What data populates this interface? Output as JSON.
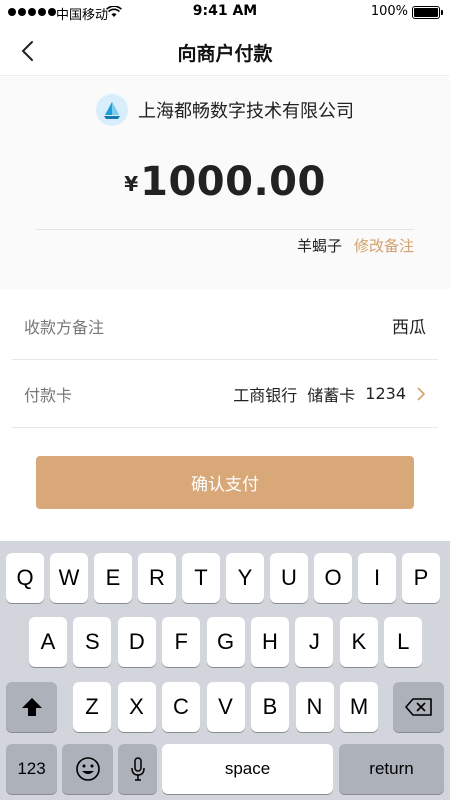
{
  "status_bar": {
    "carrier": "中国移动",
    "time": "9:41 AM",
    "battery": "100%"
  },
  "nav": {
    "title": "向商户付款"
  },
  "merchant": {
    "name": "上海都畅数字技术有限公司"
  },
  "payment": {
    "currency": "¥",
    "amount": "1000.00",
    "payer": "羊蝎子",
    "edit_note": "修改备注"
  },
  "rows": {
    "remark": {
      "label": "收款方备注",
      "value": "西瓜"
    },
    "card": {
      "label": "付款卡",
      "bank": "工商银行",
      "type": "储蓄卡",
      "last4": "1234"
    }
  },
  "confirm_label": "确认支付",
  "keyboard": {
    "row1": [
      "Q",
      "W",
      "E",
      "R",
      "T",
      "Y",
      "U",
      "O",
      "I",
      "P"
    ],
    "row2": [
      "A",
      "S",
      "D",
      "F",
      "G",
      "H",
      "J",
      "K",
      "L"
    ],
    "row3": [
      "Z",
      "X",
      "C",
      "V",
      "B",
      "N",
      "M"
    ],
    "num_label": "123",
    "space_label": "space",
    "return_label": "return"
  },
  "colors": {
    "accent": "#d9a878",
    "edit_note": "#d4a06c",
    "keyboard_bg": "#d2d5db"
  }
}
